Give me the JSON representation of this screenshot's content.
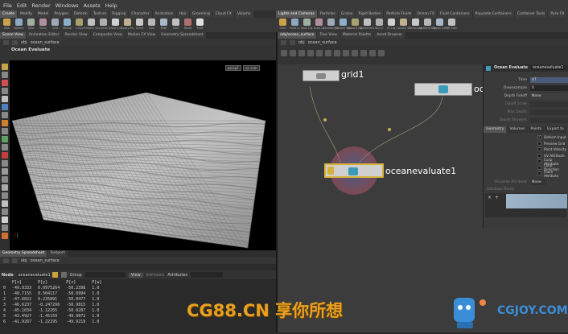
{
  "menu": [
    "File",
    "Edit",
    "Render",
    "Windows",
    "Assets",
    "Help"
  ],
  "shelf_left": {
    "tabs": [
      "Create",
      "Modify",
      "Model",
      "Polygon",
      "Deform",
      "Texture",
      "Rigging",
      "Character",
      "Animation",
      "Hair",
      "Grooming",
      "Cloud FX",
      "Volume"
    ],
    "tools": [
      "Box",
      "Sphere",
      "Tube",
      "Torus",
      "Grid",
      "Metab",
      "L-Sys",
      "Platonic So.",
      "Curve",
      "Draw Cur.",
      "Spray Pa.",
      "Circle",
      "Line",
      "Path",
      "Null",
      "Rivet",
      "Font"
    ]
  },
  "shelf_right": {
    "tabs": [
      "Lights and Cameras",
      "Particles",
      "Grains",
      "Rigid Bodies",
      "Particle Fluids",
      "Ocean FX",
      "Fluid Containers",
      "Populate Containers",
      "Container Tools",
      "Pyro FX",
      "Cloth",
      "Solid",
      "Wires",
      "Crowds",
      "Drive Simulation"
    ],
    "tools": [
      "Cam",
      "Point Li.",
      "Spot Lig.",
      "Area Li.",
      "Geometry L.",
      "Volume Lig.",
      "Distant Lig.",
      "Environme.",
      "Sky Li.",
      "GI Lig.",
      "Caustic Li.",
      "Portal Lig.",
      "Ambient Lig.",
      "Stereo Cam",
      "VR Cam"
    ]
  },
  "left_tabs": [
    "Scene View",
    "Animation Editor",
    "Render View",
    "Composite View",
    "Motion FX View",
    "Geometry Spreadsheet"
  ],
  "right_tabs": [
    "/obj/ocean_surface",
    "Tree View",
    "Material Palette",
    "Asset Browser"
  ],
  "path": {
    "obj": "obj",
    "node": "ocean_surface"
  },
  "viewport": {
    "title": "Ocean Evaluate",
    "persp": "persp1",
    "cam": "no cam"
  },
  "network": {
    "grid_label": "grid1",
    "ocean_label": "oceanevaluate1",
    "spectrum_label": "oc"
  },
  "params": {
    "header_type": "Ocean Evaluate",
    "header_name": "oceanevaluate1",
    "time_label": "Time",
    "time_value": "$T",
    "downsample_label": "Downsample",
    "downsample_value": "0",
    "depth_falloff_label": "Depth Falloff",
    "depth_falloff_value": "None",
    "falloff_scale_label": "Falloff Scale",
    "max_depth_label": "Max Depth",
    "depth_showers_label": "Depth Showers",
    "tabs": [
      "Geometry",
      "Volumes",
      "Points",
      "Export to"
    ],
    "checks": [
      {
        "label": "Deform Input",
        "on": true
      },
      {
        "label": "Preview Grid",
        "on": false
      },
      {
        "label": "Point Velocity",
        "on": false
      },
      {
        "label": "UV Attribute",
        "on": false
      },
      {
        "label": "Cusp Attribute",
        "on": false
      },
      {
        "label": "Cusp Direction",
        "on": false
      },
      {
        "label": "Foam Attribute",
        "on": false
      }
    ],
    "visualize_label": "Visualize Attribute",
    "visualize_value": "None",
    "ramp_label": "Attribute Ramp"
  },
  "spreadsheet": {
    "tabs": [
      "Geometry Spreadsheet",
      "Textport"
    ],
    "node_label": "Node",
    "node_value": "oceanevaluate1",
    "group_label": "Group",
    "view_label": "View",
    "intrinsics_label": "Intrinsics",
    "attributes_label": "Attributes",
    "headers": [
      "",
      "P[x]",
      "P[y]",
      "P[z]",
      "P[w]"
    ],
    "rows": [
      [
        "0",
        "-49.9333",
        "0.0975264",
        "-50.2398",
        "1.0"
      ],
      [
        "1",
        "-48.7155",
        "0.504117",
        "-50.0994",
        "1.0"
      ],
      [
        "2",
        "-47.6822",
        "0.235891",
        "-50.0477",
        "1.0"
      ],
      [
        "3",
        "-46.6237",
        "-0.247296",
        "-50.9815",
        "1.0"
      ],
      [
        "4",
        "-45.1034",
        "-1.12265",
        "-50.0207",
        "1.0"
      ],
      [
        "5",
        "-43.4927",
        "-1.45159",
        "-49.9072",
        "1.0"
      ],
      [
        "6",
        "-41.9267",
        "-1.22295",
        "-49.9219",
        "1.0"
      ]
    ]
  },
  "watermark": {
    "text": "CG88.CN 享你所想",
    "logo": "CGJOY.COM"
  }
}
